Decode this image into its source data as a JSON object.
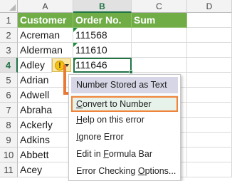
{
  "columns": [
    "A",
    "B",
    "C",
    "D"
  ],
  "rows": [
    "1",
    "2",
    "3",
    "4",
    "5",
    "6",
    "7",
    "8",
    "9",
    "10",
    "11"
  ],
  "headers": {
    "customer": "Customer",
    "order_no": "Order No.",
    "sum": "Sum"
  },
  "customers": [
    "Acreman",
    "Alderman",
    "Adley",
    "Adrian",
    "Adwell",
    "Abraha",
    "Ackerly",
    "Adkins",
    "Abbett",
    "Acey"
  ],
  "order_numbers": [
    "111568",
    "111610",
    "111646"
  ],
  "active_column": "B",
  "active_row": "4",
  "error_icon": "warning-exclamation-icon",
  "error_glyph": "!",
  "accent_color": "#70ad47",
  "highlight_color": "#f0843a",
  "menu": {
    "title": "Number Stored as Text",
    "items": [
      {
        "pre": "",
        "key": "C",
        "post": "onvert to Number"
      },
      {
        "pre": "",
        "key": "H",
        "post": "elp on this error"
      },
      {
        "pre": "",
        "key": "I",
        "post": "gnore Error"
      },
      {
        "pre": "Edit in ",
        "key": "F",
        "post": "ormula Bar"
      },
      {
        "pre": "Error Checking ",
        "key": "O",
        "post": "ptions..."
      }
    ]
  }
}
